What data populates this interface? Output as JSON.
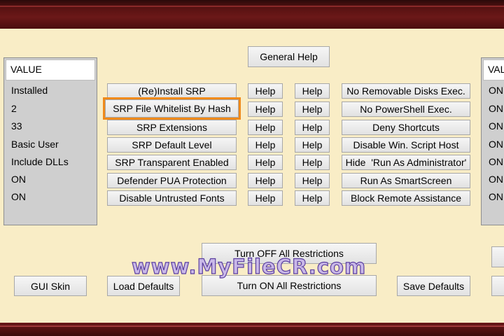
{
  "left_panel": {
    "header": "VALUE",
    "values": [
      "Installed",
      "2",
      "33",
      "Basic User",
      "Include DLLs",
      "ON",
      "ON"
    ]
  },
  "right_panel": {
    "header": "VAL",
    "values": [
      "ON",
      "ON",
      "ON",
      "ON",
      "ON",
      "ON",
      "ON"
    ]
  },
  "general_help_label": "General Help",
  "rows": [
    {
      "action": "(Re)Install SRP",
      "help1": "Help",
      "help2": "Help",
      "option": "No Removable Disks Exec."
    },
    {
      "action": "SRP File Whitelist By Hash",
      "help1": "Help",
      "help2": "Help",
      "option": "No PowerShell Exec."
    },
    {
      "action": "SRP Extensions",
      "help1": "Help",
      "help2": "Help",
      "option": "Deny Shortcuts"
    },
    {
      "action": "SRP Default Level",
      "help1": "Help",
      "help2": "Help",
      "option": "Disable Win. Script Host"
    },
    {
      "action": "SRP Transparent Enabled",
      "help1": "Help",
      "help2": "Help",
      "option": "Hide  'Run As Administrator'"
    },
    {
      "action": "Defender PUA Protection",
      "help1": "Help",
      "help2": "Help",
      "option": "Run As SmartScreen"
    },
    {
      "action": "Disable Untrusted Fonts",
      "help1": "Help",
      "help2": "Help",
      "option": "Block Remote Assistance"
    }
  ],
  "bottom": {
    "turn_off_label": "Turn OFF All Restrictions",
    "turn_on_label": "Turn ON All Restrictions",
    "gui_skin_label": "GUI Skin",
    "load_defaults_label": "Load Defaults",
    "save_defaults_label": "Save Defaults"
  },
  "watermark": "www.MyFileCR.com",
  "colors": {
    "background": "#f9edc6",
    "title_bar": "#5a1212",
    "highlight_outline": "#f08a1a",
    "panel": "#cfcfcf"
  }
}
